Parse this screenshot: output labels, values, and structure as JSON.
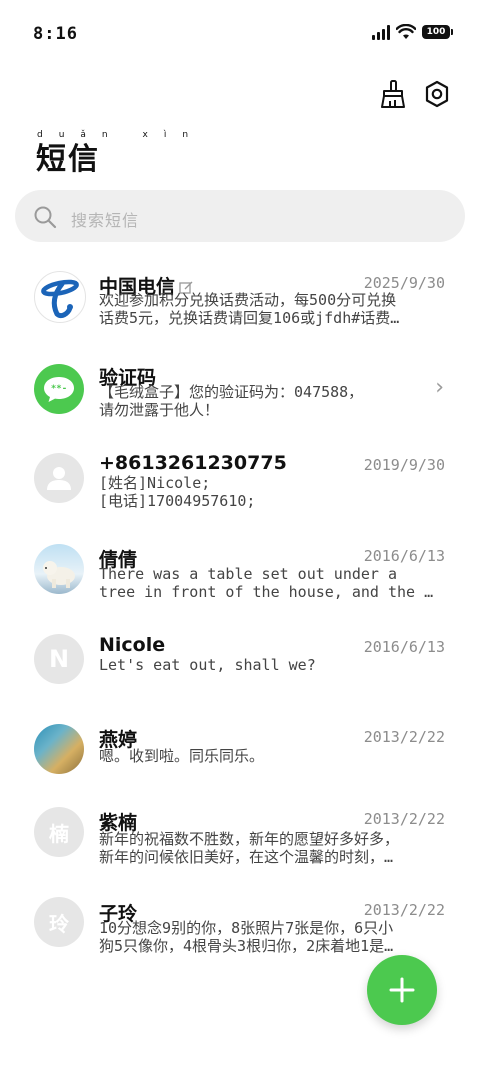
{
  "status_bar": {
    "time": "8:16",
    "battery": "100"
  },
  "header": {
    "title": "短信",
    "title_pinyin": "duǎn xìn"
  },
  "search": {
    "placeholder": "搜索短信"
  },
  "conversations": [
    {
      "name": "中国电信",
      "date": "2025/9/30",
      "line1": "欢迎参加积分兑换话费活动，每500分可兑换",
      "line2": "话费5元，兑换话费请回复106或jfdh#话费…",
      "avatar": "china-telecom-logo-icon"
    },
    {
      "name": "验证码",
      "date": "",
      "line1": "【毛绒盒子】您的验证码为：047588，",
      "line2": "请勿泄露于他人！",
      "avatar": "message-bubble-icon"
    },
    {
      "name": "+8613261230775",
      "date": "2019/9/30",
      "line1": "[姓名]Nicole;",
      "line2": "[电话]17004957610;",
      "avatar": "person-icon"
    },
    {
      "name": "倩倩",
      "date": "2016/6/13",
      "line1": "There was a table set out under a",
      "line2": "tree in front of the house, and the …",
      "avatar": "polar-bear-photo"
    },
    {
      "name": "Nicole",
      "date": "2016/6/13",
      "line1": "Let's eat out, shall we?",
      "line2": "",
      "avatar_letter": "N"
    },
    {
      "name": "燕婷",
      "date": "2013/2/22",
      "line1": "嗯。收到啦。同乐同乐。",
      "line2": "",
      "avatar": "landscape-photo"
    },
    {
      "name": "紫楠",
      "date": "2013/2/22",
      "line1": "新年的祝福数不胜数，新年的愿望好多好多，",
      "line2": "新年的问候依旧美好，在这个温馨的时刻，…",
      "avatar_letter": "楠"
    },
    {
      "name": "子玲",
      "date": "2013/2/22",
      "line1": "10分想念9别的你，8张照片7张是你，6只小",
      "line2": "狗5只像你，4根骨头3根归你，2床着地1是…",
      "avatar_letter": "玲"
    }
  ],
  "colors": {
    "accent": "#4cc94f",
    "telecom_blue": "#1b64b8"
  }
}
